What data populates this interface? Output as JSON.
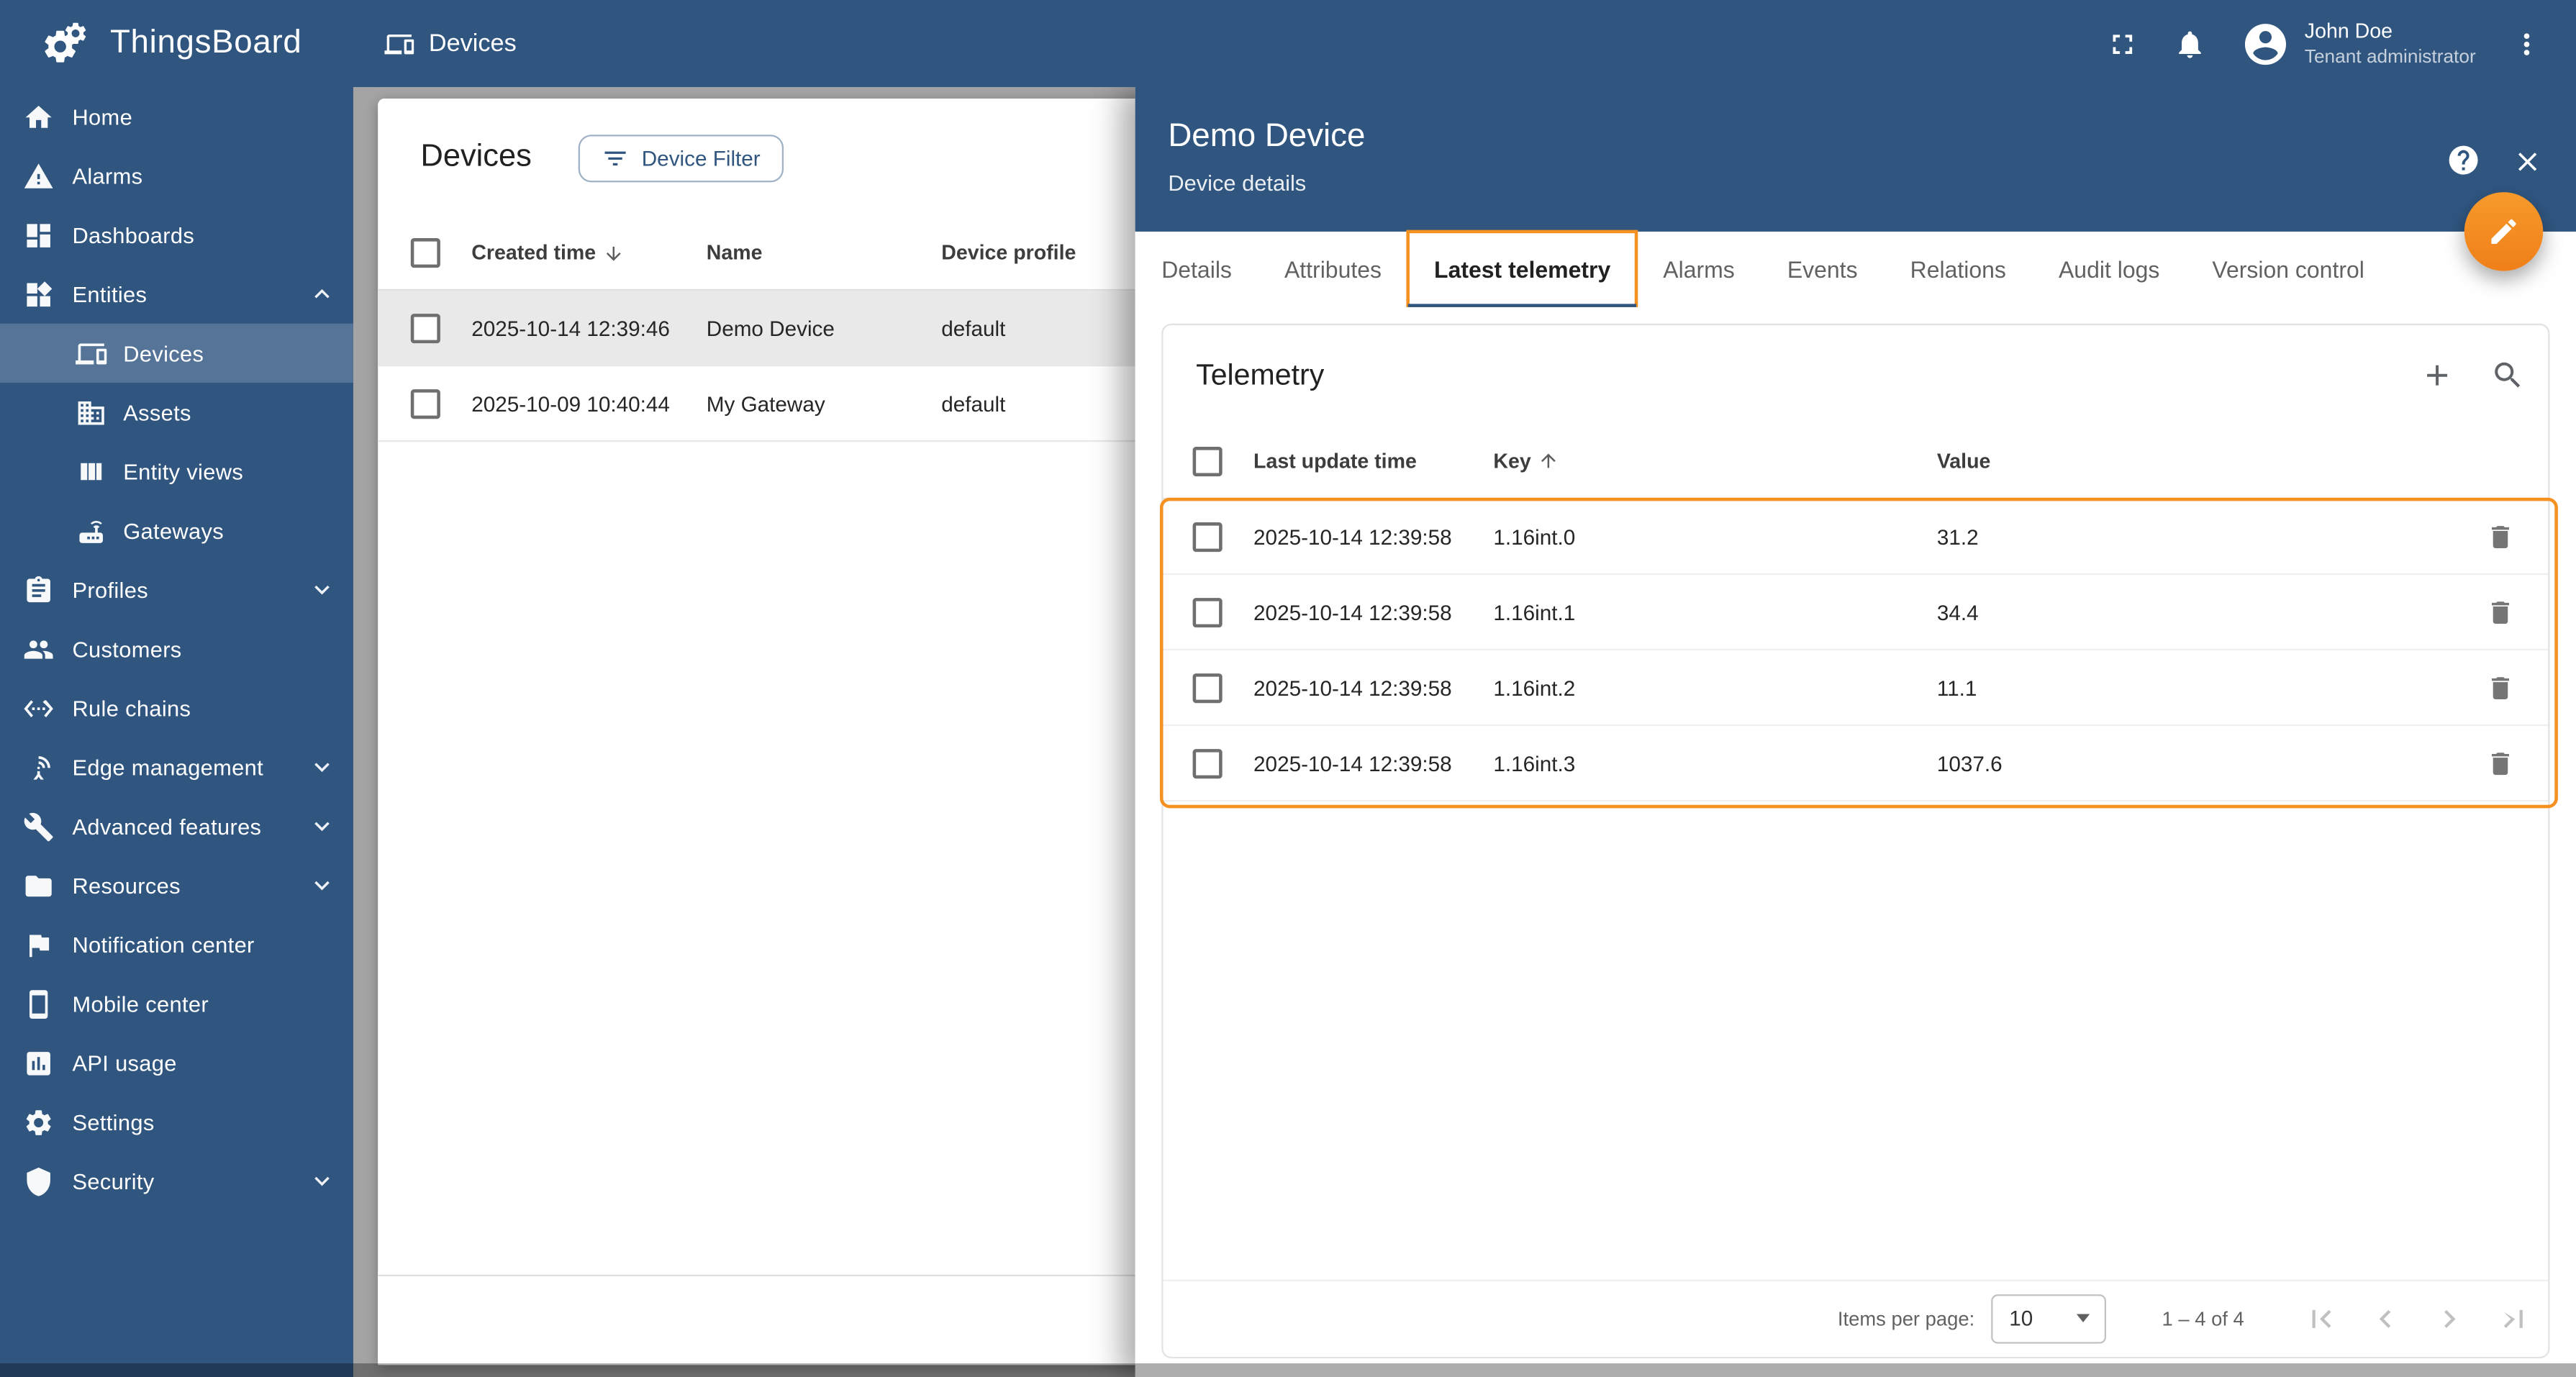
{
  "colors": {
    "primary": "#305680",
    "highlight_orange": "#F59120",
    "fab_orange": "#F4871E",
    "selected_row": "#e9e9e9"
  },
  "header": {
    "app_name": "ThingsBoard",
    "page_title": "Devices",
    "user": {
      "name": "John Doe",
      "role": "Tenant administrator"
    }
  },
  "sidebar": {
    "items": [
      {
        "label": "Home"
      },
      {
        "label": "Alarms"
      },
      {
        "label": "Dashboards"
      },
      {
        "label": "Entities"
      },
      {
        "label": "Devices"
      },
      {
        "label": "Assets"
      },
      {
        "label": "Entity views"
      },
      {
        "label": "Gateways"
      },
      {
        "label": "Profiles"
      },
      {
        "label": "Customers"
      },
      {
        "label": "Rule chains"
      },
      {
        "label": "Edge management"
      },
      {
        "label": "Advanced features"
      },
      {
        "label": "Resources"
      },
      {
        "label": "Notification center"
      },
      {
        "label": "Mobile center"
      },
      {
        "label": "API usage"
      },
      {
        "label": "Settings"
      },
      {
        "label": "Security"
      }
    ],
    "active_item": "Devices"
  },
  "devices_panel": {
    "title": "Devices",
    "filter_button_label": "Device Filter",
    "columns": [
      "Created time",
      "Name",
      "Device profile"
    ],
    "sort_column": "Created time",
    "rows": [
      {
        "created_time": "2025-10-14 12:39:46",
        "name": "Demo Device",
        "profile": "default"
      },
      {
        "created_time": "2025-10-09 10:40:44",
        "name": "My Gateway",
        "profile": "default"
      }
    ]
  },
  "drawer": {
    "title": "Demo Device",
    "subtitle": "Device details",
    "tabs": [
      "Details",
      "Attributes",
      "Latest telemetry",
      "Alarms",
      "Events",
      "Relations",
      "Audit logs",
      "Version control"
    ],
    "active_tab": "Latest telemetry",
    "telemetry": {
      "title": "Telemetry",
      "columns": [
        "Last update time",
        "Key",
        "Value"
      ],
      "sort_column": "Key",
      "rows": [
        {
          "time": "2025-10-14 12:39:58",
          "key": "1.16int.0",
          "value": "31.2"
        },
        {
          "time": "2025-10-14 12:39:58",
          "key": "1.16int.1",
          "value": "34.4"
        },
        {
          "time": "2025-10-14 12:39:58",
          "key": "1.16int.2",
          "value": "11.1"
        },
        {
          "time": "2025-10-14 12:39:58",
          "key": "1.16int.3",
          "value": "1037.6"
        }
      ],
      "pagination": {
        "items_per_page_label": "Items per page:",
        "items_per_page_value": "10",
        "range_label": "1 – 4 of 4"
      }
    }
  }
}
